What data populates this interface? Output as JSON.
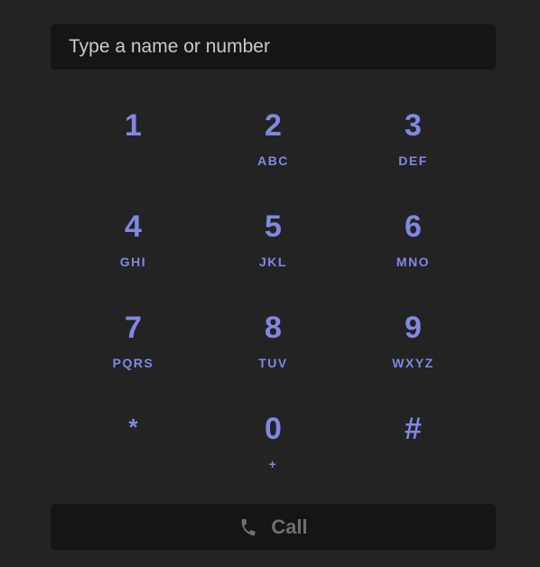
{
  "search": {
    "placeholder": "Type a name or number",
    "value": ""
  },
  "keypad": {
    "keys": [
      {
        "digit": "1",
        "letters": ""
      },
      {
        "digit": "2",
        "letters": "ABC"
      },
      {
        "digit": "3",
        "letters": "DEF"
      },
      {
        "digit": "4",
        "letters": "GHI"
      },
      {
        "digit": "5",
        "letters": "JKL"
      },
      {
        "digit": "6",
        "letters": "MNO"
      },
      {
        "digit": "7",
        "letters": "PQRS"
      },
      {
        "digit": "8",
        "letters": "TUV"
      },
      {
        "digit": "9",
        "letters": "WXYZ"
      },
      {
        "digit": "*",
        "letters": ""
      },
      {
        "digit": "0",
        "letters": "+"
      },
      {
        "digit": "#",
        "letters": ""
      }
    ]
  },
  "call": {
    "label": "Call",
    "icon": "phone-icon",
    "enabled": false
  },
  "colors": {
    "background": "#232323",
    "field": "#151515",
    "accent": "#8287e4",
    "disabled_text": "#6f6f6f",
    "placeholder": "#c9c9c9"
  }
}
